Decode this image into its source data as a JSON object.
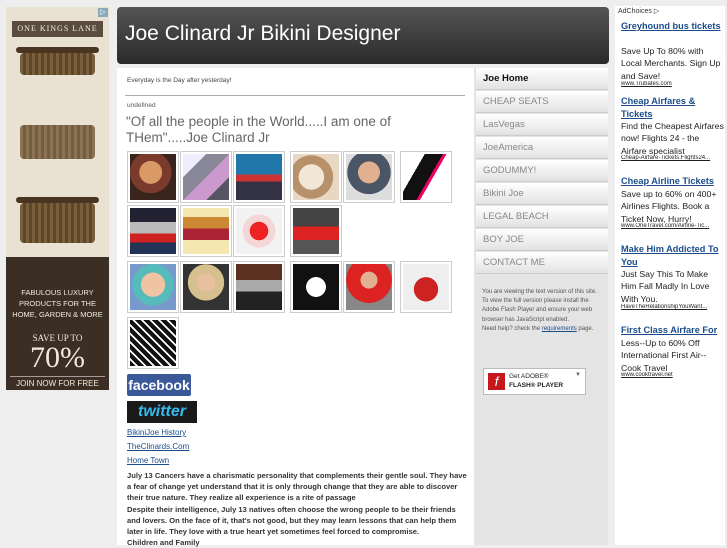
{
  "left_ad": {
    "brand": "ONE KINGS LANE",
    "headline": "FABULOUS LUXURY PRODUCTS FOR THE HOME, GARDEN & MORE",
    "save_label": "SAVE UP TO",
    "percent": "70%",
    "cta": "JOIN NOW FOR FREE"
  },
  "header": {
    "title": "Joe Clinard Jr Bikini Designer"
  },
  "main": {
    "tagline": "Everyday is the Day after yesterday!",
    "label": "undefined",
    "quote": "\"Of all the people in the World.....I am one of THem\".....Joe Clinard Jr",
    "facebook_label": "facebook",
    "twitter_label": "twitter",
    "links": [
      "BikiniJoe History",
      "TheClinards.Com",
      "Home Town"
    ],
    "bio": "July 13 Cancers have a charismatic personality that complements their gentle soul. They have a fear of change yet understand that it is only through change that they are able to discover their true nature. They realize all experience is a rite of passage\nDespite their intelligence, July 13 natives often choose the wrong people to be their friends and lovers. On the face of it, that's not good, but they may learn lessons that can help them later in life. They love with a true heart yet sometimes feel forced to compromise.\nChildren and Family"
  },
  "nav": {
    "items": [
      "Joe Home",
      "CHEAP SEATS",
      "LasVegas",
      "JoeAmerica",
      "GODUMMY!",
      "Bikini Joe",
      "LEGAL BEACH",
      "BOY JOE",
      "CONTACT ME"
    ],
    "note_text": "You are viewing the text version of this site.\nTo view the full version please install the Adobe Flash Player and ensure your web browser has JavaScript enabled.\nNeed help? check the ",
    "note_link": "requirements",
    "note_tail": " page.",
    "flash_line1": "Get ADOBE®",
    "flash_line2": "FLASH® PLAYER"
  },
  "right_ads": {
    "adchoices": "AdChoices",
    "ads": [
      {
        "title": "Greyhound bus tickets",
        "body": "Save Up To 80% with Local Merchants. Sign Up and Save!",
        "url": "www.Trubates.com"
      },
      {
        "title": "Cheap Airfares & Tickets",
        "body": "Find the Cheapest Airfares now! Flights 24 - the Airfare specialist",
        "url": "Cheap-Airfare-Tickets.Flights24..."
      },
      {
        "title": "Cheap Airline Tickets",
        "body": "Save up to 60% on 400+ Airlines Flights. Book a Ticket Now, Hurry!",
        "url": "www.OneTravel.com/Airline-Tic..."
      },
      {
        "title": "Make Him Addicted To You",
        "body": "Just Say This To Make Him Fall Madly In Love With You.",
        "url": "HaveTheRelationshipYouWant..."
      },
      {
        "title": "First Class Airfare For",
        "body": "Less--Up to 60% Off International First Air-- Cook Travel",
        "url": "www.cooktravel.net"
      }
    ]
  }
}
